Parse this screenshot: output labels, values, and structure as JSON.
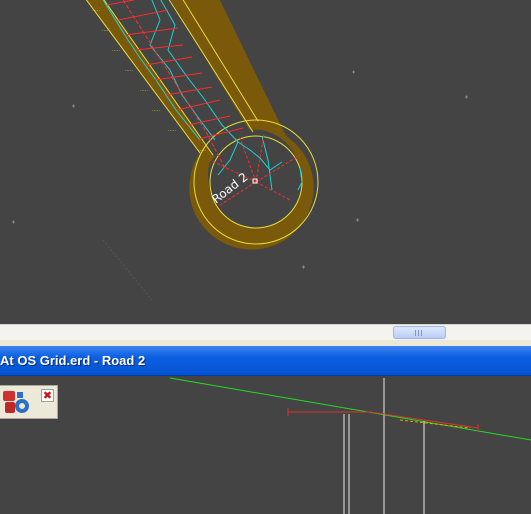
{
  "plan": {
    "road_label": "Road 2",
    "colors": {
      "background": "#444444",
      "road_fill": "#7a5a0a",
      "road_edge": "#e6dd3a",
      "centreline": "#ff3030",
      "breaklines": "#19d3d3",
      "sections": "#ff2a2a",
      "grid_marks": "#8a8a8a"
    }
  },
  "window": {
    "title": "At OS Grid.erd - Road 2"
  },
  "toolbar": {
    "tool_icon": "road-tools-icon",
    "close_icon": "close-icon",
    "close_glyph": "✖"
  },
  "profile": {
    "colors": {
      "ground_line": "#22dd22",
      "vertical_lines": "#e8e8e8",
      "design_line": "#dd3030"
    }
  }
}
